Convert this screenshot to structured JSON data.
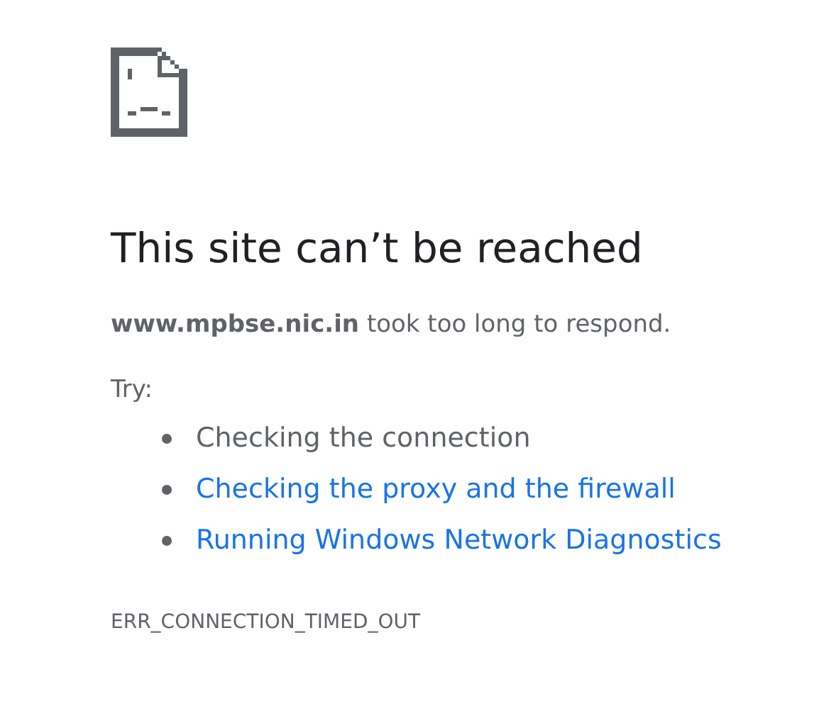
{
  "heading": "This site can’t be reached",
  "description": "**www.mpbse.nic.in** took too long to respond.",
  "try_label": "Try:",
  "suggestions": [
    {
      "kind": "text",
      "label": "Checking the connection"
    },
    {
      "kind": "link",
      "label": "Checking the proxy and the firewall"
    },
    {
      "kind": "link",
      "label": "Running Windows Network Diagnostics"
    }
  ],
  "error_code": "ERR_CONNECTION_TIMED_OUT"
}
